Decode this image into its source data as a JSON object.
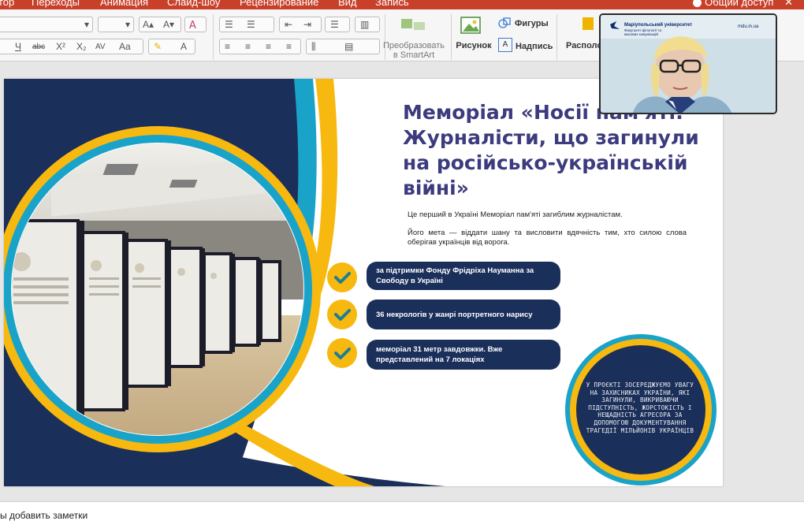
{
  "menubar": {
    "items": [
      "тор",
      "Переходы",
      "Анимация",
      "Слайд-шоу",
      "Рецензирование",
      "Вид",
      "Запись"
    ],
    "share_label": "Общий доступ",
    "close_symbol": "✕"
  },
  "ribbon": {
    "smartart_label": "Преобразовать в SmartArt",
    "picture_label": "Рисунок",
    "shapes_label": "Фигуры",
    "textbox_label": "Надпись",
    "arrange_label": "Располо",
    "format_buttons": [
      "Ч",
      "abc",
      "X²",
      "X₂",
      "AV",
      "Aa",
      "A"
    ],
    "font_size_buttons": [
      "A▴",
      "A▾"
    ]
  },
  "slide": {
    "title": "Меморіал «Носії пам'яті: Журналісти, що загинули на російсько-українській війні»",
    "intro": "Це перший в Україні Меморіал пам'яті загиблим журналістам.",
    "purpose": "Його мета — віддати шану та висловити вдячність тим, хто силою слова оберігав українців від ворога.",
    "items": [
      {
        "label": "за підтримки Фонду Фрідріха Науманна за Свободу в Україні"
      },
      {
        "label": "36 некрологів у жанрі портретного нарису"
      },
      {
        "label": "меморіал 31 метр завдовжки. Вже представлений на 7 локаціях"
      }
    ],
    "circle_text": "У ПРОЄКТІ ЗОСЕРЕДЖУЄМО УВАГУ НА ЗАХИСНИКАХ УКРАЇНИ, ЯКІ ЗАГИНУЛИ, ВИКРИВАЮЧИ ПІДСТУПНІСТЬ, ЖОРСТОКІСТЬ І НЕЩАДНІСТЬ АГРЕСОРА ЗА ДОПОМОГОЮ ДОКУМЕНТУВАННЯ ТРАГЕДІЇ МІЛЬЙОНІВ УКРАЇНЦІВ",
    "colors": {
      "navy": "#1b2f5b",
      "yellow": "#f7b90f",
      "teal": "#1aa3c9",
      "title": "#3b3b7e"
    }
  },
  "notes": {
    "placeholder": "ы добавить заметки"
  },
  "webcam": {
    "brand": "Маріупольський університет",
    "subbrand": "Факультет філології та масових комунікацій",
    "site": "mdu.in.ua"
  }
}
